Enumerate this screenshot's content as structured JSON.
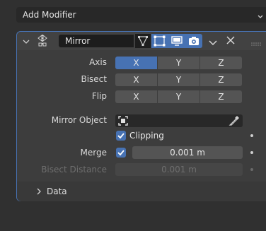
{
  "add_modifier": {
    "label": "Add Modifier"
  },
  "modifier": {
    "name": "Mirror",
    "rows": {
      "axis": {
        "label": "Axis",
        "options": [
          "X",
          "Y",
          "Z"
        ]
      },
      "bisect": {
        "label": "Bisect",
        "options": [
          "X",
          "Y",
          "Z"
        ]
      },
      "flip": {
        "label": "Flip",
        "options": [
          "X",
          "Y",
          "Z"
        ]
      }
    },
    "mirror_object": {
      "label": "Mirror Object",
      "value": ""
    },
    "clipping": {
      "label": "Clipping",
      "checked": true
    },
    "merge": {
      "label": "Merge",
      "checked": true,
      "value": "0.001 m"
    },
    "bisect_distance": {
      "label": "Bisect Distance",
      "value": "0.001 m"
    },
    "data_section": {
      "label": "Data",
      "expanded": false
    }
  },
  "colors": {
    "accent": "#4772b3",
    "panel": "#3d3d3d",
    "background": "#303030"
  }
}
